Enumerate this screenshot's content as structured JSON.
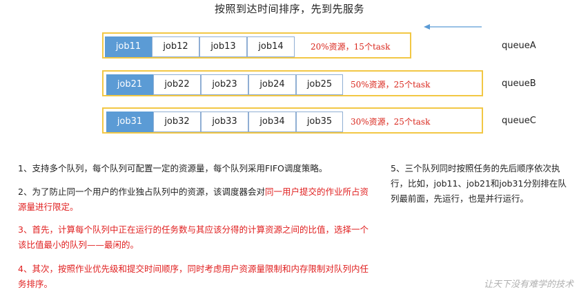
{
  "title": "按照到达时间排序，先到先服务",
  "queues": [
    {
      "label": "queueA",
      "jobs": [
        "job11",
        "job12",
        "job13",
        "job14"
      ],
      "resource": "20%资源，15个task"
    },
    {
      "label": "queueB",
      "jobs": [
        "job21",
        "job22",
        "job23",
        "job24",
        "job25"
      ],
      "resource": "50%资源，25个task"
    },
    {
      "label": "queueC",
      "jobs": [
        "job31",
        "job32",
        "job33",
        "job34",
        "job35"
      ],
      "resource": "30%资源，25个task"
    }
  ],
  "notes": {
    "n1": "1、支持多个队列，每个队列可配置一定的资源量，每个队列采用FIFO调度策略。",
    "n2_a": "2、为了防止同一个用户的作业独占队列中的资源，该调度器会对",
    "n2_b": "同一用户提交的作业所占资源量进行限定。",
    "n3": "3、首先，计算每个队列中正在运行的任务数与其应该分得的计算资源之间的比值，选择一个该比值最小的队列——最闲的。",
    "n4": "4、其次，按照作业优先级和提交时间顺序，同时考虑用户资源量限制和内存限制对队列内任务排序。",
    "n5": "5、三个队列同时按照任务的先后顺序依次执行，比如，job11、job21和job31分别排在队列最前面，先运行，也是并行运行。"
  },
  "watermark": "让天下没有难学的技术",
  "colors": {
    "queue_border": "#f2c744",
    "first_job": "#5b9bd5",
    "job_border": "#8faed3",
    "highlight_red": "#e02020",
    "arrow": "#5b9bd5"
  }
}
